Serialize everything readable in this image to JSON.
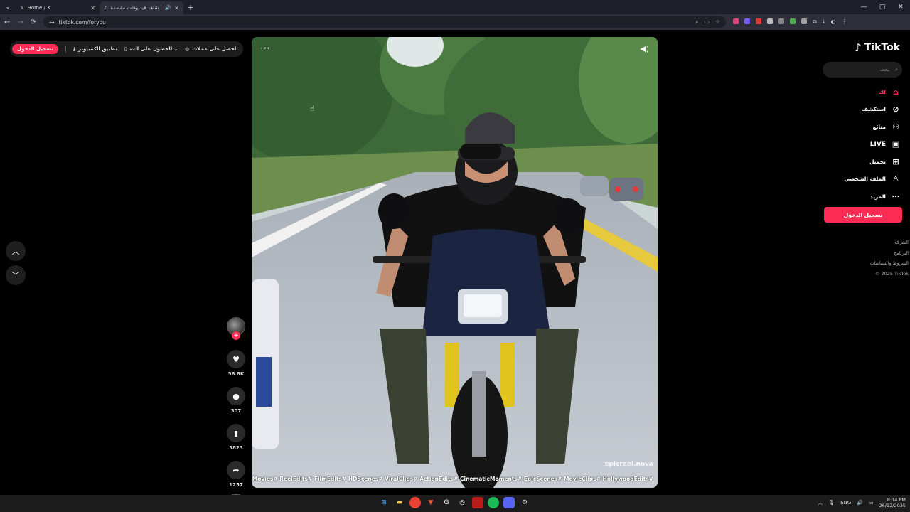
{
  "browser": {
    "tabs": [
      {
        "title": "Home / X",
        "icon": "x-logo-icon",
        "active": false
      },
      {
        "title": "شاهد فيديوهات مقصدة | Tik...",
        "icon": "tiktok-icon",
        "active": true
      }
    ],
    "url": "tiktok.com/foryou",
    "window_controls": [
      "—",
      "▢",
      "✕"
    ]
  },
  "topbar": {
    "login": "تسجيل الدخول",
    "app_download": "تطبيق الكمبيوتر",
    "get_app": "الحصول على الت...",
    "coins": "احصل على عملات"
  },
  "video": {
    "watermark": "epicreel.nova",
    "hashtags": "TrendingMovies# ReelEdits# FilmEdits# HDScenes# ViralClips# ActionEdits# CinematicMoments# EpicScenes# MovieClips# HollywoodEdits#"
  },
  "actions": {
    "likes": "56.8K",
    "comments": "307",
    "saves": "3823",
    "shares": "1257"
  },
  "sidebar": {
    "brand": "TikTok",
    "search_placeholder": "بحث",
    "items": [
      {
        "label": "لك",
        "icon": "home-icon",
        "active": true
      },
      {
        "label": "استكشف",
        "icon": "compass-icon",
        "active": false
      },
      {
        "label": "متابَع",
        "icon": "user-follow-icon",
        "active": false
      },
      {
        "label": "LIVE",
        "icon": "live-icon",
        "active": false
      },
      {
        "label": "تحميل",
        "icon": "upload-icon",
        "active": false
      },
      {
        "label": "الملف الشخصي",
        "icon": "profile-icon",
        "active": false
      },
      {
        "label": "المزيد",
        "icon": "more-icon",
        "active": false
      }
    ],
    "login_button": "تسجيل الدخول",
    "footer": [
      "الشركة",
      "البرنامج",
      "الشروط والسياسات",
      "© 2025 TikTok"
    ]
  },
  "taskbar": {
    "language": "ENG",
    "time": "8:14 PM",
    "date": "26/12/2025"
  },
  "colors": {
    "accent": "#fe2c55"
  }
}
